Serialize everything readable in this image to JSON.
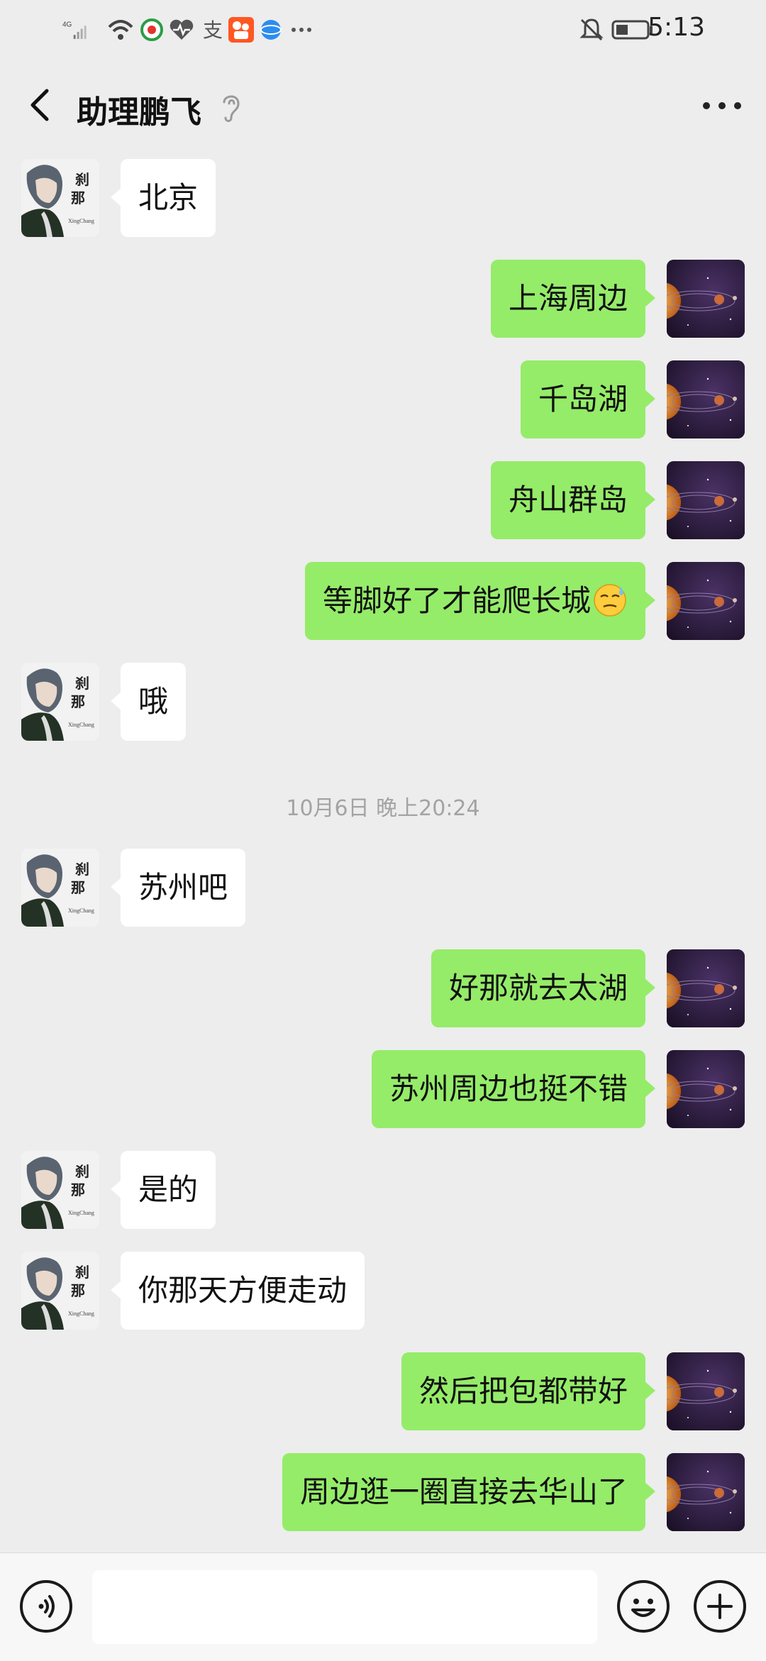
{
  "status_bar": {
    "network": "4G",
    "time": "5:13"
  },
  "header": {
    "title": "助理鹏飞"
  },
  "messages": [
    {
      "side": "left",
      "text": "北京"
    },
    {
      "side": "right",
      "text": "上海周边"
    },
    {
      "side": "right",
      "text": "千岛湖"
    },
    {
      "side": "right",
      "text": "舟山群岛"
    },
    {
      "side": "right",
      "text": "等脚好了才能爬长城",
      "emoji": "sweat-emoji"
    },
    {
      "side": "left",
      "text": "哦"
    },
    {
      "side": "timestamp",
      "text": "10月6日 晚上20:24"
    },
    {
      "side": "left",
      "text": "苏州吧"
    },
    {
      "side": "right",
      "text": "好那就去太湖"
    },
    {
      "side": "right",
      "text": "苏州周边也挺不错"
    },
    {
      "side": "left",
      "text": "是的"
    },
    {
      "side": "left",
      "text": "你那天方便走动"
    },
    {
      "side": "right",
      "text": "然后把包都带好"
    },
    {
      "side": "right",
      "text": "周边逛一圈直接去华山了"
    }
  ],
  "contact_avatar": {
    "text_line1": "刹",
    "text_line2": "那",
    "caption": "XingChang"
  },
  "input_bar": {
    "value": "",
    "left_icon": "voice-icon",
    "emoji_icon": "emoji-icon",
    "plus_icon": "plus-icon"
  },
  "colors": {
    "background": "#ededed",
    "sent_bubble": "#95ec69",
    "received_bubble": "#ffffff",
    "timestamp_text": "#a3a3a3"
  }
}
